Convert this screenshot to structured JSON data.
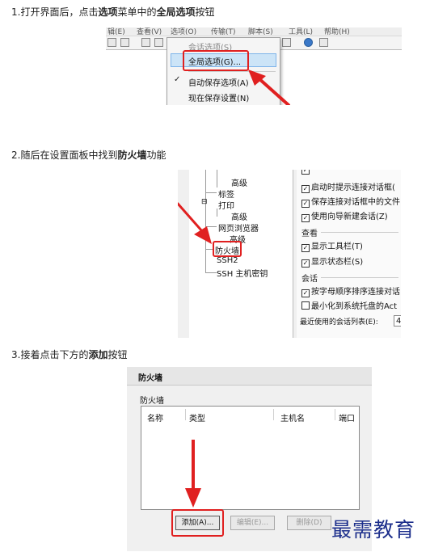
{
  "steps": [
    {
      "number": "1.",
      "parts": [
        {
          "text": "打开界面后，点击",
          "bold": false
        },
        {
          "text": "选项",
          "bold": true
        },
        {
          "text": "菜单中的",
          "bold": false
        },
        {
          "text": "全局选项",
          "bold": true
        },
        {
          "text": "按钮",
          "bold": false
        }
      ]
    },
    {
      "number": "2.",
      "parts": [
        {
          "text": "随后在设置面板中找到",
          "bold": false
        },
        {
          "text": "防火墙",
          "bold": true
        },
        {
          "text": "功能",
          "bold": false
        }
      ]
    },
    {
      "number": "3.",
      "parts": [
        {
          "text": "接着点击下方的",
          "bold": false
        },
        {
          "text": "添加",
          "bold": true
        },
        {
          "text": "按钮",
          "bold": false
        }
      ]
    }
  ],
  "shot1": {
    "menubar": [
      "辑(E)",
      "查看(V)",
      "选项(O)",
      "传输(T)",
      "脚本(S)",
      "工具(L)",
      "帮助(H)"
    ],
    "menu_items": {
      "session_options": "会话选项(S)",
      "global_options": "全局选项(G)...",
      "auto_save": "自动保存选项(A)",
      "save_now": "现在保存设置(N)"
    },
    "check_glyph": "✓"
  },
  "shot2": {
    "tree": {
      "advanced_1": "高级",
      "tabs": "标签",
      "print": "打印",
      "advanced_2": "高级",
      "web_browser": "网页浏览器",
      "advanced_3": "高级",
      "firewall": "防火墙",
      "ssh2": "SSH2",
      "ssh_host_keys": "SSH 主机密钥"
    },
    "options": {
      "startup_dialog": "启动时提示连接对话框(",
      "save_in_dialog": "保存连接对话框中的文件",
      "use_wizard": "使用向导新建会话(Z)"
    },
    "view_group": "查看",
    "view_options": {
      "toolbar": "显示工具栏(T)",
      "statusbar": "显示状态栏(S)"
    },
    "session_group": "会话",
    "session_options": {
      "sort_order": "按字母顺序排序连接对话",
      "minimize_tray": "最小化到系统托盘的Act"
    },
    "recent_label": "最近使用的会话列表(E):",
    "recent_value": "4",
    "check_glyph": "✓"
  },
  "shot3": {
    "title": "防火墙",
    "group_label": "防火墙",
    "columns": [
      "名称",
      "类型",
      "主机名",
      "端口"
    ],
    "buttons": {
      "add": "添加(A)...",
      "edit": "编辑(E)...",
      "delete": "删除(D)"
    }
  },
  "watermark": "最需教育",
  "colors": {
    "highlight": "#e02020",
    "watermark": "#1d2f8c"
  }
}
